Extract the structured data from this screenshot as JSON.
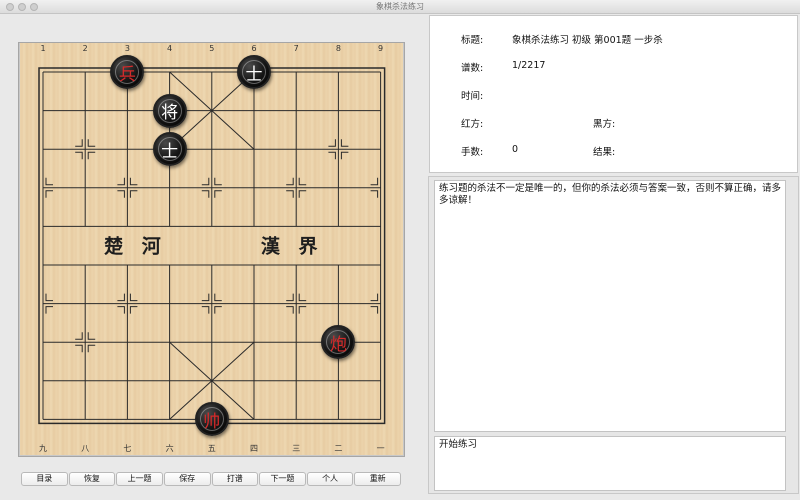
{
  "window": {
    "title": "象棋杀法练习"
  },
  "board": {
    "top_coords": [
      "1",
      "2",
      "3",
      "4",
      "5",
      "6",
      "7",
      "8",
      "9"
    ],
    "bottom_coords": [
      "九",
      "八",
      "七",
      "六",
      "五",
      "四",
      "三",
      "二",
      "一"
    ],
    "river_left": "楚 河",
    "river_right": "漢 界",
    "pieces": [
      {
        "char": "兵",
        "color": "red",
        "col": 2,
        "row": 0
      },
      {
        "char": "士",
        "color": "black",
        "col": 5,
        "row": 0
      },
      {
        "char": "将",
        "color": "black",
        "col": 3,
        "row": 1
      },
      {
        "char": "士",
        "color": "black",
        "col": 3,
        "row": 2
      },
      {
        "char": "炮",
        "color": "red",
        "col": 7,
        "row": 7
      },
      {
        "char": "帅",
        "color": "red",
        "col": 4,
        "row": 9
      }
    ]
  },
  "buttons": [
    "目录",
    "恢复",
    "上一题",
    "保存",
    "打谱",
    "下一题",
    "个人",
    "重新"
  ],
  "info": {
    "title_label": "标题:",
    "title_value": "象棋杀法练习 初级 第001题 一步杀",
    "count_label": "谱数:",
    "count_value": "1/2217",
    "time_label": "时间:",
    "time_value": "",
    "red_label": "红方:",
    "red_value": "",
    "black_label": "黑方:",
    "black_value": "",
    "moves_label": "手数:",
    "moves_value": "0",
    "result_label": "结果:",
    "result_value": ""
  },
  "note": "练习题的杀法不一定是唯一的，但你的杀法必须与答案一致，否则不算正确，请多多谅解！",
  "move_list": "开始练习"
}
